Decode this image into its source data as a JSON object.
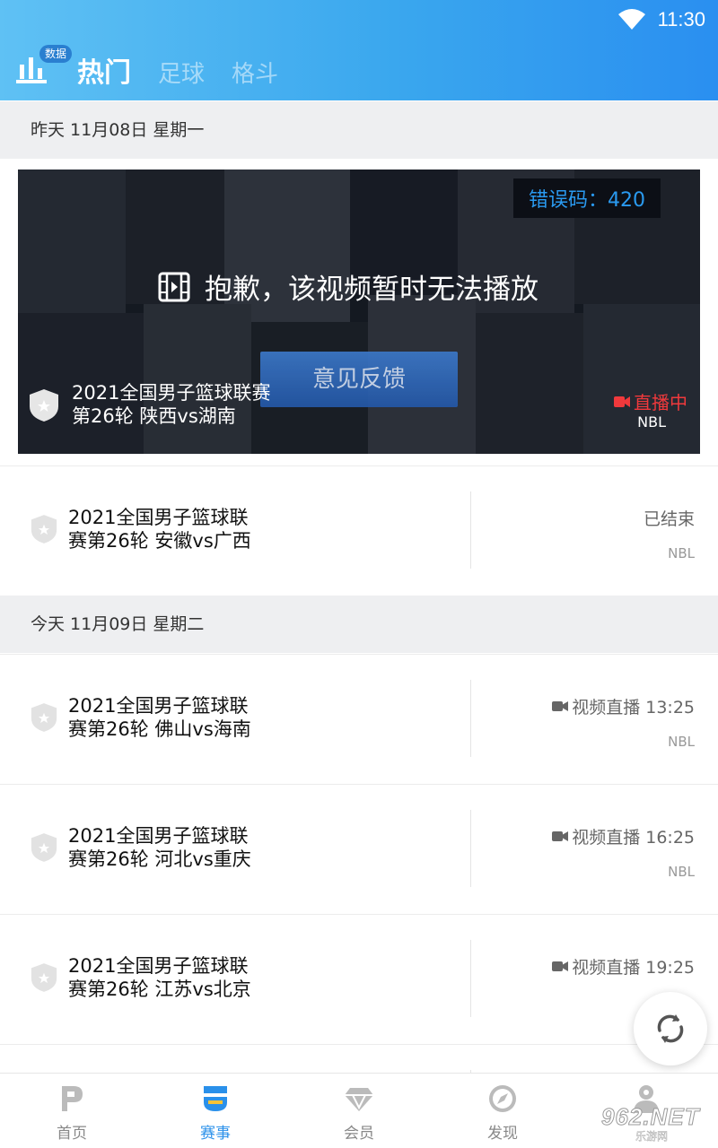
{
  "status_bar": {
    "time": "11:30"
  },
  "header": {
    "data_badge": "数据",
    "tabs": [
      {
        "label": "热门",
        "active": true
      },
      {
        "label": "足球",
        "active": false
      },
      {
        "label": "格斗",
        "active": false
      }
    ]
  },
  "dates": {
    "yesterday": "昨天 11月08日 星期一",
    "today": "今天 11月09日 星期二"
  },
  "player": {
    "error_code": "错误码：420",
    "message": "抱歉，该视频暂时无法播放",
    "feedback_button": "意见反馈",
    "title_line1": "2021全国男子篮球联赛",
    "title_line2": "第26轮 陕西vs湖南",
    "live_label": "直播中",
    "league": "NBL"
  },
  "matches": [
    {
      "line1": "2021全国男子篮球联",
      "line2": "赛第26轮 安徽vs广西",
      "status": "已结束",
      "league": "NBL",
      "video": false
    },
    {
      "line1": "2021全国男子篮球联",
      "line2": "赛第26轮 佛山vs海南",
      "status": "视频直播 13:25",
      "league": "NBL",
      "video": true
    },
    {
      "line1": "2021全国男子篮球联",
      "line2": "赛第26轮 河北vs重庆",
      "status": "视频直播 16:25",
      "league": "NBL",
      "video": true
    },
    {
      "line1": "2021全国男子篮球联",
      "line2": "赛第26轮 江苏vs北京",
      "status": "视频直播 19:25",
      "league": "",
      "video": true
    }
  ],
  "bottom_nav": [
    {
      "label": "首页",
      "icon": "home-p-icon",
      "active": false
    },
    {
      "label": "赛事",
      "icon": "match-icon",
      "active": true
    },
    {
      "label": "会员",
      "icon": "diamond-icon",
      "active": false
    },
    {
      "label": "发现",
      "icon": "compass-icon",
      "active": false
    },
    {
      "label": "",
      "icon": "profile-icon",
      "active": false
    }
  ],
  "watermark": {
    "text": "962.NET",
    "sub": "乐游网"
  },
  "colors": {
    "accent": "#2a90ea",
    "live": "#f0393c",
    "header_start": "#5fc1f4",
    "header_end": "#2a8ff0"
  }
}
